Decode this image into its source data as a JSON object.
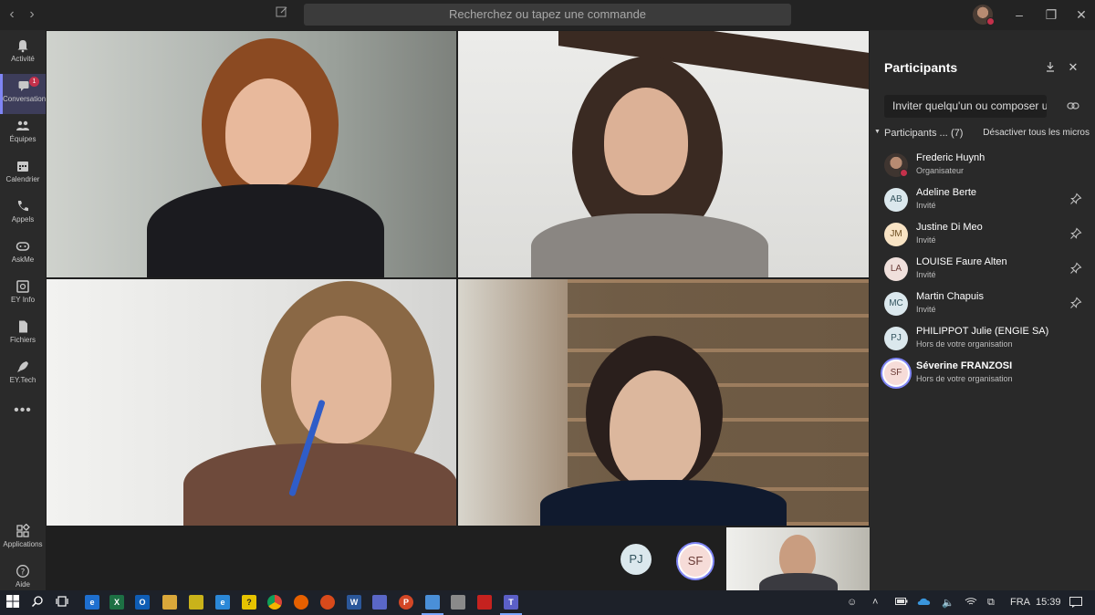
{
  "titlebar": {
    "back_glyph": "‹",
    "forward_glyph": "›",
    "search_placeholder": "Recherchez ou tapez une commande",
    "window_controls": [
      "–",
      "❐",
      "✕"
    ]
  },
  "rail": {
    "items": [
      {
        "label": "Activité",
        "icon": "bell-icon"
      },
      {
        "label": "Conversation",
        "icon": "chat-icon",
        "badge": "1",
        "active": true
      },
      {
        "label": "Équipes",
        "icon": "teams-icon"
      },
      {
        "label": "Calendrier",
        "icon": "calendar-icon"
      },
      {
        "label": "Appels",
        "icon": "phone-icon"
      },
      {
        "label": "AskMe",
        "icon": "askme-icon"
      },
      {
        "label": "EY Info",
        "icon": "info-icon"
      },
      {
        "label": "Fichiers",
        "icon": "files-icon"
      },
      {
        "label": "EY.Tech",
        "icon": "rocket-icon"
      }
    ],
    "more": "•••",
    "bottom": [
      {
        "label": "Applications",
        "icon": "apps-icon"
      },
      {
        "label": "Aide",
        "icon": "help-icon"
      }
    ]
  },
  "stage": {
    "tiles": [
      "participant-video-1",
      "participant-video-2",
      "participant-video-3",
      "participant-video-4"
    ],
    "overflow_avatars": [
      {
        "initials": "PJ",
        "color": "#dbe8ed"
      },
      {
        "initials": "SF",
        "color": "#f6dcd8"
      }
    ]
  },
  "panel": {
    "title": "Participants",
    "invite_placeholder": "Inviter quelqu'un ou composer un numéro",
    "section_label": "Participants ...",
    "section_count": "(7)",
    "mute_all": "Désactiver tous les micros",
    "people": [
      {
        "name": "Frederic Huynh",
        "role": "Organisateur",
        "initials": "",
        "photo": true,
        "pin": false
      },
      {
        "name": "Adeline Berte",
        "role": "Invité",
        "initials": "AB",
        "color": "#dbe8ed",
        "text": "#33545e",
        "pin": true
      },
      {
        "name": "Justine Di Meo",
        "role": "Invité",
        "initials": "JM",
        "color": "#f8e3c4",
        "text": "#6b4b1e",
        "pin": true
      },
      {
        "name": "LOUISE Faure Alten",
        "role": "Invité",
        "initials": "LA",
        "color": "#f0e0dc",
        "text": "#6a3b36",
        "pin": true
      },
      {
        "name": "Martin Chapuis",
        "role": "Invité",
        "initials": "MC",
        "color": "#dbe8ed",
        "text": "#33545e",
        "pin": true
      },
      {
        "name": "PHILIPPOT Julie (ENGIE SA)",
        "role": "Hors de votre organisation",
        "initials": "PJ",
        "color": "#dbe8ed",
        "text": "#33545e",
        "pin": false
      },
      {
        "name": "Séverine FRANZOSI",
        "role": "Hors de votre organisation",
        "initials": "SF",
        "color": "#f6dcd8",
        "text": "#6a3b36",
        "pin": false,
        "selected": true
      }
    ]
  },
  "taskbar": {
    "apps": [
      {
        "icon": "edge-legacy-icon",
        "color": "#1e6fd0",
        "glyph": "e"
      },
      {
        "icon": "excel-icon",
        "color": "#1d7044",
        "glyph": "X"
      },
      {
        "icon": "outlook-icon",
        "color": "#0f5db5",
        "glyph": "O"
      },
      {
        "icon": "explorer-icon",
        "color": "#d9a73a",
        "glyph": ""
      },
      {
        "icon": "notes-icon",
        "color": "#c9b21a",
        "glyph": ""
      },
      {
        "icon": "ie-icon",
        "color": "#2b88d8",
        "glyph": "e"
      },
      {
        "icon": "help-app-icon",
        "color": "#e6c300",
        "glyph": "?"
      },
      {
        "icon": "chrome-icon",
        "color": "#db4437",
        "glyph": ""
      },
      {
        "icon": "firefox-icon",
        "color": "#e66000",
        "glyph": ""
      },
      {
        "icon": "firefox-alt-icon",
        "color": "#d84a1b",
        "glyph": ""
      },
      {
        "icon": "word-icon",
        "color": "#2b579a",
        "glyph": "W"
      },
      {
        "icon": "save-app-icon",
        "color": "#5a67c7",
        "glyph": ""
      },
      {
        "icon": "powerpoint-icon",
        "color": "#d24726",
        "glyph": "P"
      },
      {
        "icon": "remote-icon",
        "color": "#4a8fd8",
        "glyph": ""
      },
      {
        "icon": "snip-icon",
        "color": "#8a8a8a",
        "glyph": ""
      },
      {
        "icon": "acrobat-icon",
        "color": "#c5221f",
        "glyph": ""
      },
      {
        "icon": "teams-task-icon",
        "color": "#5b5fc7",
        "glyph": "T"
      }
    ],
    "tray_language": "FRA",
    "tray_time": "15:39"
  }
}
